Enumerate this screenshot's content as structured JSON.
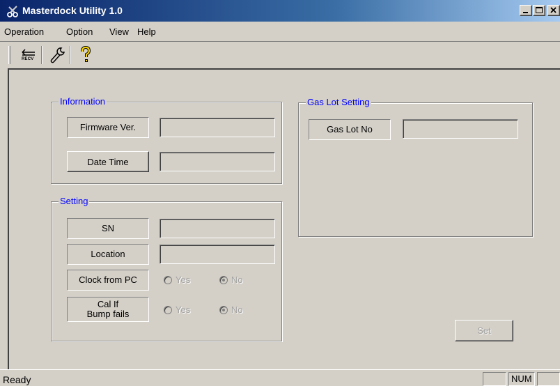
{
  "window": {
    "title": "Masterdock Utility 1.0",
    "icon": "scissors-icon"
  },
  "menu": [
    "Operation",
    "Option",
    "View",
    "Help"
  ],
  "toolbar": {
    "items": [
      {
        "name": "recv-button",
        "icon": "arrow-left-icon",
        "label": "RECV"
      },
      {
        "name": "settings-button",
        "icon": "wrench-icon"
      },
      {
        "name": "help-button",
        "icon": "question-icon"
      }
    ]
  },
  "information": {
    "title": "Information",
    "firmware_label": "Firmware Ver.",
    "firmware_value": "",
    "datetime_label": "Date Time",
    "datetime_value": ""
  },
  "setting": {
    "title": "Setting",
    "sn_label": "SN",
    "sn_value": "",
    "location_label": "Location",
    "location_value": "",
    "clock_label": "Clock from PC",
    "clock_yes": "Yes",
    "clock_no": "No",
    "clock_selected": "No",
    "cal_label_line1": "Cal If",
    "cal_label_line2": "Bump fails",
    "cal_yes": "Yes",
    "cal_no": "No",
    "cal_selected": "No"
  },
  "gas_lot": {
    "title": "Gas Lot Setting",
    "label": "Gas Lot No",
    "value": ""
  },
  "set_button": "Set",
  "status": {
    "text": "Ready",
    "num": "NUM"
  }
}
